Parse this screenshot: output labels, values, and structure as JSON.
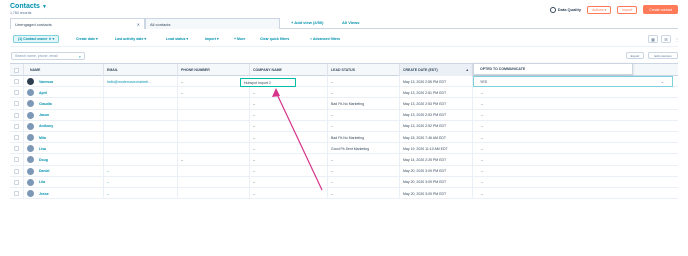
{
  "header": {
    "title": "Contacts",
    "records": "1,784 records",
    "data_quality": "Data Quality",
    "actions_label": "Actions ▾",
    "import_label": "Import",
    "create_label": "Create contact"
  },
  "tabs": [
    {
      "label": "Unengaged contacts",
      "active": true,
      "closable": true
    },
    {
      "label": "All contacts",
      "active": false,
      "closable": false
    }
  ],
  "add_view": "+ Add view (2/50)",
  "all_views": "All Views",
  "filters": {
    "active_chip": "(1) Contact owner",
    "items": [
      "Create date",
      "Last activity date",
      "Lead status",
      "Import",
      "+ More",
      "Clear quick filters",
      "Advanced filters"
    ]
  },
  "search": {
    "placeholder": "Search name, phone, email"
  },
  "table_tools": {
    "export": "Export",
    "edit_columns": "Edit columns"
  },
  "columns": [
    "NAME",
    "EMAIL",
    "PHONE NUMBER",
    "COMPANY NAME",
    "LEAD STATUS",
    "CREATE DATE (EDT)"
  ],
  "popup": {
    "column": "OPTED TO COMMUNICATE",
    "value": "YES"
  },
  "editing_value": "Hubspot Import 2",
  "rows": [
    {
      "name": "Vanessa",
      "email": "hello@modernova.marketi...",
      "phone": "--",
      "company": "",
      "lead": "--",
      "date": "May 13, 2020 2:55 PM EDT",
      "avatar": "dark"
    },
    {
      "name": "April",
      "email": "",
      "phone": "--",
      "company": "--",
      "lead": "--",
      "date": "May 13, 2020 2:51 PM EDT",
      "avatar": "light"
    },
    {
      "name": "Claudia",
      "email": "",
      "phone": "",
      "company": "--",
      "lead": "Bad Fit-No Marketing",
      "date": "May 13, 2020 2:53 PM EDT",
      "avatar": "light"
    },
    {
      "name": "Jason",
      "email": "",
      "phone": "",
      "company": "--",
      "lead": "--",
      "date": "May 13, 2020 2:53 PM EDT",
      "avatar": "light"
    },
    {
      "name": "Anthony",
      "email": "",
      "phone": "",
      "company": "--",
      "lead": "--",
      "date": "May 13, 2020 2:52 PM EDT",
      "avatar": "light"
    },
    {
      "name": "Mila",
      "email": "",
      "phone": "",
      "company": "--",
      "lead": "Bad Fit-No Marketing",
      "date": "May 18, 2020 7:46 AM EDT",
      "avatar": "light"
    },
    {
      "name": "Lisa",
      "email": "",
      "phone": "",
      "company": "--",
      "lead": "Good Fit-Sent Marketing",
      "date": "May 19, 2020 11:10 AM EDT",
      "avatar": "light"
    },
    {
      "name": "Doug",
      "email": "",
      "phone": "--",
      "company": "--",
      "lead": "--",
      "date": "May 14, 2020 2:25 PM EDT",
      "avatar": "light"
    },
    {
      "name": "Daniel",
      "email": "--",
      "phone": "",
      "company": "--",
      "lead": "--",
      "date": "May 20, 2020 3:09 PM EDT",
      "avatar": "light"
    },
    {
      "name": "Lila",
      "email": "--",
      "phone": "",
      "company": "--",
      "lead": "--",
      "date": "May 20, 2020 3:09 PM EDT",
      "avatar": "light"
    },
    {
      "name": "Jesse",
      "email": "--",
      "phone": "",
      "company": "--",
      "lead": "--",
      "date": "May 20, 2020 3:09 PM EDT",
      "avatar": "light"
    }
  ],
  "colors": {
    "accent": "#0091ae",
    "primary_button": "#ff7a59",
    "annotation_arrow": "#d6338a",
    "edit_outline": "#00bda5"
  }
}
